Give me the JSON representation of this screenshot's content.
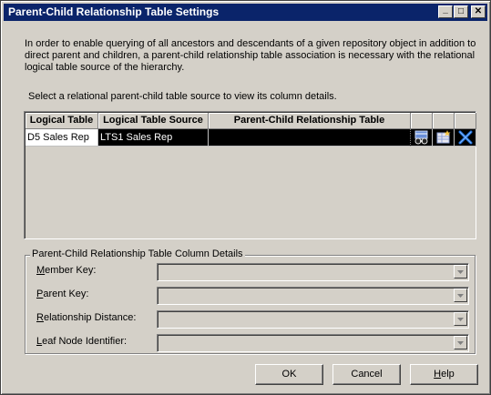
{
  "window": {
    "title": "Parent-Child Relationship Table Settings",
    "minimize_glyph": "_",
    "maximize_glyph": "□",
    "close_glyph": "✕"
  },
  "description": "In order to enable querying of all ancestors and descendants of a given repository object in addition to direct parent and children, a parent-child relationship table association is necessary with the relational logical table source of the hierarchy.",
  "select_hint": "Select a relational parent-child table source to view its column details.",
  "grid": {
    "columns": [
      "Logical Table",
      "Logical Table Source",
      "Parent-Child Relationship Table"
    ],
    "rows": [
      {
        "logical_table": "D5 Sales Rep",
        "logical_table_source": "LTS1 Sales Rep",
        "pc_table": ""
      }
    ],
    "row_icons": [
      "browse-icon",
      "create-table-icon",
      "delete-icon"
    ]
  },
  "details": {
    "legend": "Parent-Child Relationship Table Column Details",
    "fields": [
      {
        "label_pre": "",
        "label_key": "M",
        "label_post": "ember Key:",
        "value": ""
      },
      {
        "label_pre": "",
        "label_key": "P",
        "label_post": "arent Key:",
        "value": ""
      },
      {
        "label_pre": "",
        "label_key": "R",
        "label_post": "elationship Distance:",
        "value": ""
      },
      {
        "label_pre": "",
        "label_key": "L",
        "label_post": "eaf Node Identifier:",
        "value": ""
      }
    ]
  },
  "buttons": {
    "ok": "OK",
    "cancel": "Cancel",
    "help_key": "H",
    "help_rest": "elp"
  },
  "colors": {
    "titlebar": "#0a246a",
    "dialog_bg": "#d4d0c8",
    "selected_row": "#000000",
    "delete_icon": "#1f6fd6"
  }
}
